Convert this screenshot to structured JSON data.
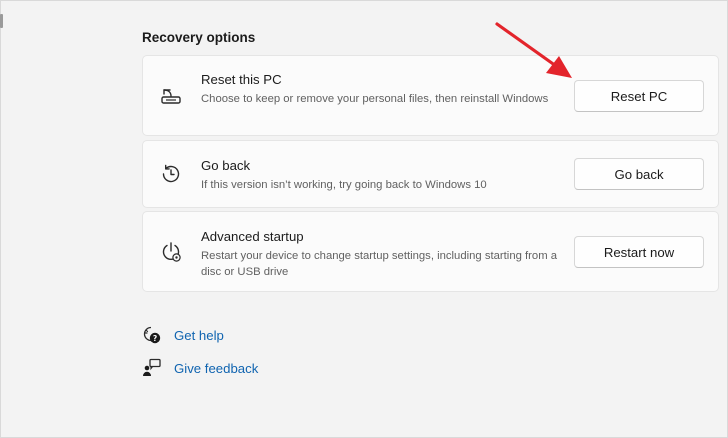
{
  "section": {
    "title": "Recovery options"
  },
  "recovery_options": [
    {
      "title": "Reset this PC",
      "description": "Choose to keep or remove your personal files, then reinstall Windows",
      "button": "Reset PC",
      "icon": "reset-pc-icon"
    },
    {
      "title": "Go back",
      "description": "If this version isn’t working, try going back to Windows 10",
      "button": "Go back",
      "icon": "history-icon"
    },
    {
      "title": "Advanced startup",
      "description": "Restart your device to change startup settings, including starting from a disc or USB drive",
      "button": "Restart now",
      "icon": "advanced-startup-icon"
    }
  ],
  "links": [
    {
      "label": "Get help",
      "icon": "get-help-icon"
    },
    {
      "label": "Give feedback",
      "icon": "give-feedback-icon"
    }
  ],
  "colors": {
    "page_background": "#f3f3f3",
    "card_background": "#fbfbfb",
    "link": "#1064b0",
    "annotation_arrow": "#e3242b"
  }
}
